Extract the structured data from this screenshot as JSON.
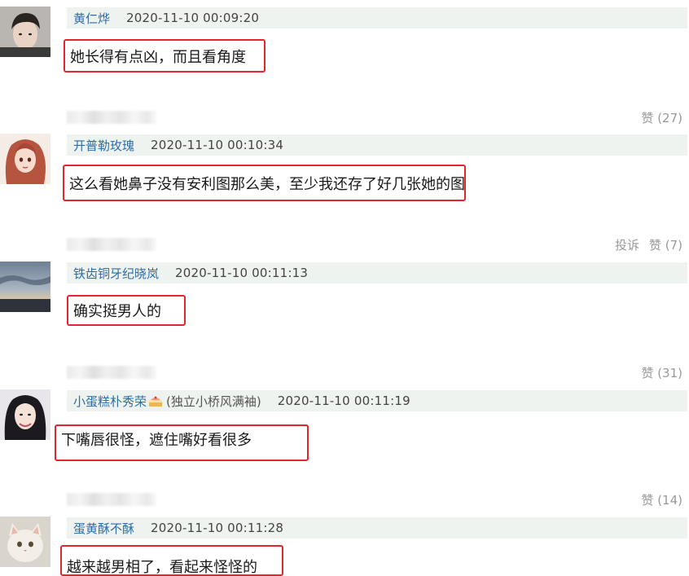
{
  "comments": [
    {
      "username": "黄仁烨",
      "timestamp": "2020-11-10 00:09:20",
      "content": "她长得有点凶，而且看角度",
      "actions": {
        "report": "",
        "like": "赞 (27)"
      },
      "avatar_icon": "avatar-boy-photo"
    },
    {
      "username": "开普勒玫瑰",
      "timestamp": "2020-11-10 00:10:34",
      "content": "这么看她鼻子没有安利图那么美，至少我还存了好几张她的图",
      "actions": {
        "report": "投诉",
        "like": "赞 (7)"
      },
      "avatar_icon": "avatar-anime-girl"
    },
    {
      "username": "铁齿铜牙纪晓岚",
      "timestamp": "2020-11-10 00:11:13",
      "content": "确实挺男人的",
      "actions": {
        "report": "",
        "like": "赞 (31)"
      },
      "avatar_icon": "avatar-sky-landscape"
    },
    {
      "username": "小蛋糕朴秀荣",
      "sub_name": "(独立小桥风满袖)",
      "timestamp": "2020-11-10 00:11:19",
      "content": "下嘴唇很怪，遮住嘴好看很多",
      "actions": {
        "report": "",
        "like": "赞 (14)"
      },
      "avatar_icon": "avatar-girl-photo"
    },
    {
      "username": "蛋黄酥不酥",
      "timestamp": "2020-11-10 00:11:28",
      "content": "越来越男相了，看起来怪怪的",
      "avatar_icon": "avatar-cat-photo"
    }
  ]
}
